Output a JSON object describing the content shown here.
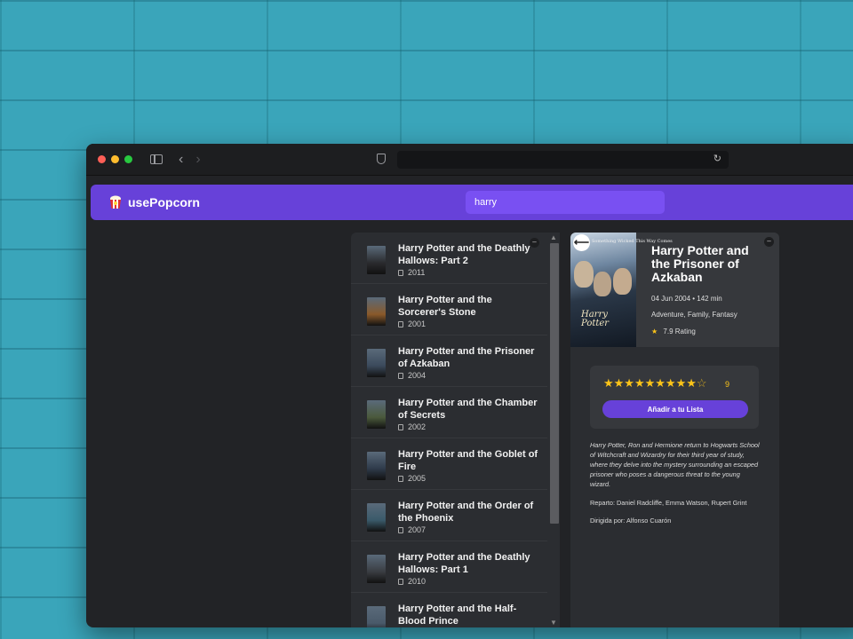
{
  "app": {
    "name": "usePopcorn"
  },
  "search": {
    "value": "harry"
  },
  "list_toggle_label": "–",
  "movies": [
    {
      "title": "Harry Potter and the Deathly Hallows: Part 2",
      "year": "2011",
      "poster_color": "#2a2b2e"
    },
    {
      "title": "Harry Potter and the Sorcerer's Stone",
      "year": "2001",
      "poster_color": "#8a5a2a"
    },
    {
      "title": "Harry Potter and the Prisoner of Azkaban",
      "year": "2004",
      "poster_color": "#3b4a5c"
    },
    {
      "title": "Harry Potter and the Chamber of Secrets",
      "year": "2002",
      "poster_color": "#4b5a3c"
    },
    {
      "title": "Harry Potter and the Goblet of Fire",
      "year": "2005",
      "poster_color": "#2e3a4a"
    },
    {
      "title": "Harry Potter and the Order of the Phoenix",
      "year": "2007",
      "poster_color": "#3a5a6a"
    },
    {
      "title": "Harry Potter and the Deathly Hallows: Part 1",
      "year": "2010",
      "poster_color": "#3a3d42"
    },
    {
      "title": "Harry Potter and the Half-Blood Prince",
      "year": "",
      "poster_color": "#4a5a6a"
    }
  ],
  "detail": {
    "title": "Harry Potter and the Prisoner of Azkaban",
    "release_runtime": "04 Jun 2004 • 142 min",
    "genre": "Adventure, Family, Fantasy",
    "imdb_rating": "7.9 Rating",
    "star_glyph": "★",
    "close_label": "–",
    "back_label": "⟵",
    "poster_tagline": "Something Wicked This Way Comes",
    "poster_logo": "Harry Potter",
    "user_stars_filled": "★★★★★★★★★",
    "user_stars_empty": "☆",
    "user_rating": "9",
    "add_button_label": "Añadir a tu Lista",
    "plot": "Harry Potter, Ron and Hermione return to Hogwarts School of Witchcraft and Wizardry for their third year of study, where they delve into the mystery surrounding an escaped prisoner who poses a dangerous threat to the young wizard.",
    "cast": "Reparto: Daniel Radcliffe, Emma Watson, Rupert Grint",
    "director": "Dirigida por: Alfonso Cuarón"
  },
  "colors": {
    "accent": "#6741d9",
    "search_bg": "#7950f2",
    "star": "#fcc419",
    "panel_bg": "#2b2d31"
  }
}
